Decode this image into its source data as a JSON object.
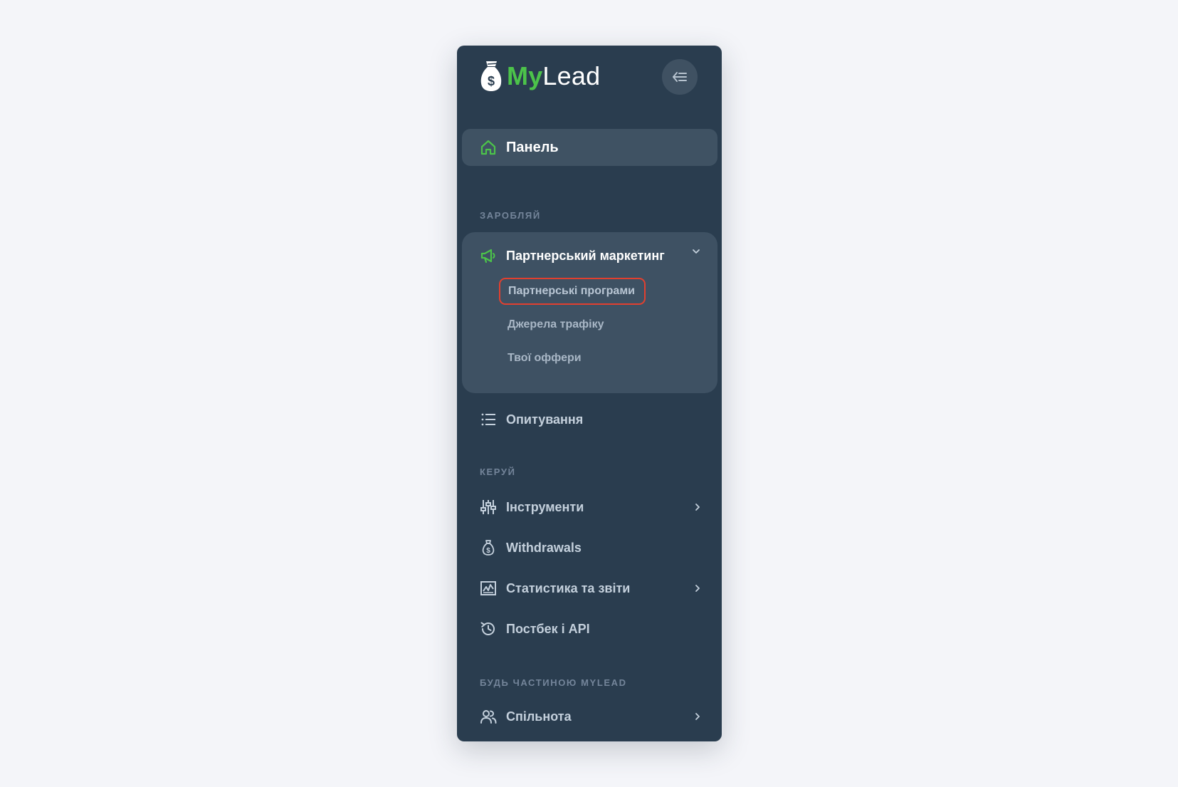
{
  "brand": {
    "name_part1": "My",
    "name_part2": "Lead",
    "accent_color": "#4cc34a"
  },
  "header": {
    "collapse_icon": "collapse-menu-icon"
  },
  "nav": {
    "dashboard": {
      "label": "Панель",
      "icon": "home-icon",
      "active": true
    },
    "sections": [
      {
        "title": "ЗАРОБЛЯЙ",
        "items": [
          {
            "label": "Партнерський маркетинг",
            "icon": "megaphone-icon",
            "expanded": true,
            "children": [
              {
                "label": "Партнерські програми",
                "highlighted": true
              },
              {
                "label": "Джерела трафіку"
              },
              {
                "label": "Твої оффери"
              }
            ]
          },
          {
            "label": "Опитування",
            "icon": "list-icon"
          }
        ]
      },
      {
        "title": "КЕРУЙ",
        "items": [
          {
            "label": "Інструменти",
            "icon": "sliders-icon",
            "has_children": true
          },
          {
            "label": "Withdrawals",
            "icon": "money-bag-icon"
          },
          {
            "label": "Статистика та звіти",
            "icon": "chart-icon",
            "has_children": true
          },
          {
            "label": "Постбек і API",
            "icon": "history-icon"
          }
        ]
      },
      {
        "title": "БУДЬ ЧАСТИНОЮ MYLEAD",
        "items": [
          {
            "label": "Спільнота",
            "icon": "users-icon",
            "has_children": true
          }
        ]
      }
    ]
  },
  "colors": {
    "sidebar_bg": "#2a3d4f",
    "active_bg": "#3f5263",
    "highlight_border": "#e2402f"
  }
}
